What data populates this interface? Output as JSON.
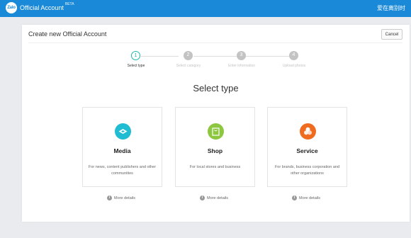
{
  "header": {
    "logo_text": "Zalo",
    "app_name": "Official Account",
    "beta_badge": "BETA",
    "user_name": "爱在离别时",
    "bar_color": "#1a8ad8"
  },
  "panel": {
    "title": "Create new Official Account",
    "cancel_label": "Cancel"
  },
  "stepper": {
    "steps": [
      {
        "number": "1",
        "label": "Select type",
        "state": "active"
      },
      {
        "number": "2",
        "label": "Select category",
        "state": "inactive"
      },
      {
        "number": "3",
        "label": "Enter information",
        "state": "inactive"
      },
      {
        "number": "4",
        "label": "Upload photos",
        "state": "inactive"
      }
    ],
    "active_color": "#1db6ae"
  },
  "heading": "Select type",
  "cards": [
    {
      "icon": "media-icon",
      "icon_color": "#1fbcd2",
      "title": "Media",
      "description": "For news, content publishers and other communities",
      "more_label": "More details"
    },
    {
      "icon": "shop-icon",
      "icon_color": "#8dc63f",
      "title": "Shop",
      "description": "For local stores and business",
      "more_label": "More details"
    },
    {
      "icon": "service-icon",
      "icon_color": "#ef6b1f",
      "title": "Service",
      "description": "For brands, business corporation and other organizations",
      "more_label": "More details"
    }
  ]
}
